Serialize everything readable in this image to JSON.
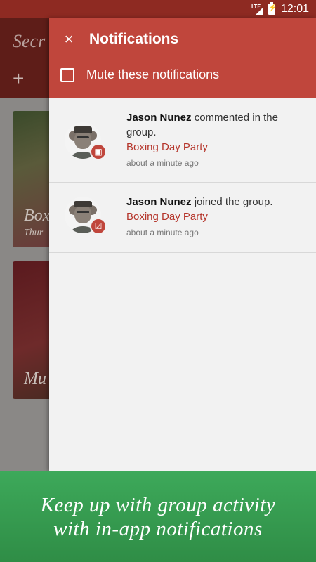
{
  "status_bar": {
    "network": "LTE",
    "time": "12:01",
    "icons": [
      "lte-signal-icon",
      "battery-charging-icon"
    ]
  },
  "background": {
    "app_title": "Secr",
    "add_symbol": "+",
    "cards": [
      {
        "title": "Box",
        "subtitle": "Thur"
      },
      {
        "title": "Mu"
      }
    ]
  },
  "drawer": {
    "close_symbol": "×",
    "title": "Notifications",
    "mute_label": "Mute these notifications",
    "mute_checked": false,
    "accent_color": "#c0463c",
    "notifications": [
      {
        "user": "Jason Nunez",
        "action": " commented in the group.",
        "group": "Boxing Day Party",
        "time": "about a minute ago",
        "badge_icon": "comment-icon",
        "badge_symbol": "▣"
      },
      {
        "user": "Jason Nunez",
        "action": " joined the group.",
        "group": "Boxing Day Party",
        "time": "about a minute ago",
        "badge_icon": "check-icon",
        "badge_symbol": "☑"
      }
    ]
  },
  "banner": {
    "line1": "Keep up with group activity",
    "line2": "with in-app notifications",
    "color": "#3da95a"
  }
}
